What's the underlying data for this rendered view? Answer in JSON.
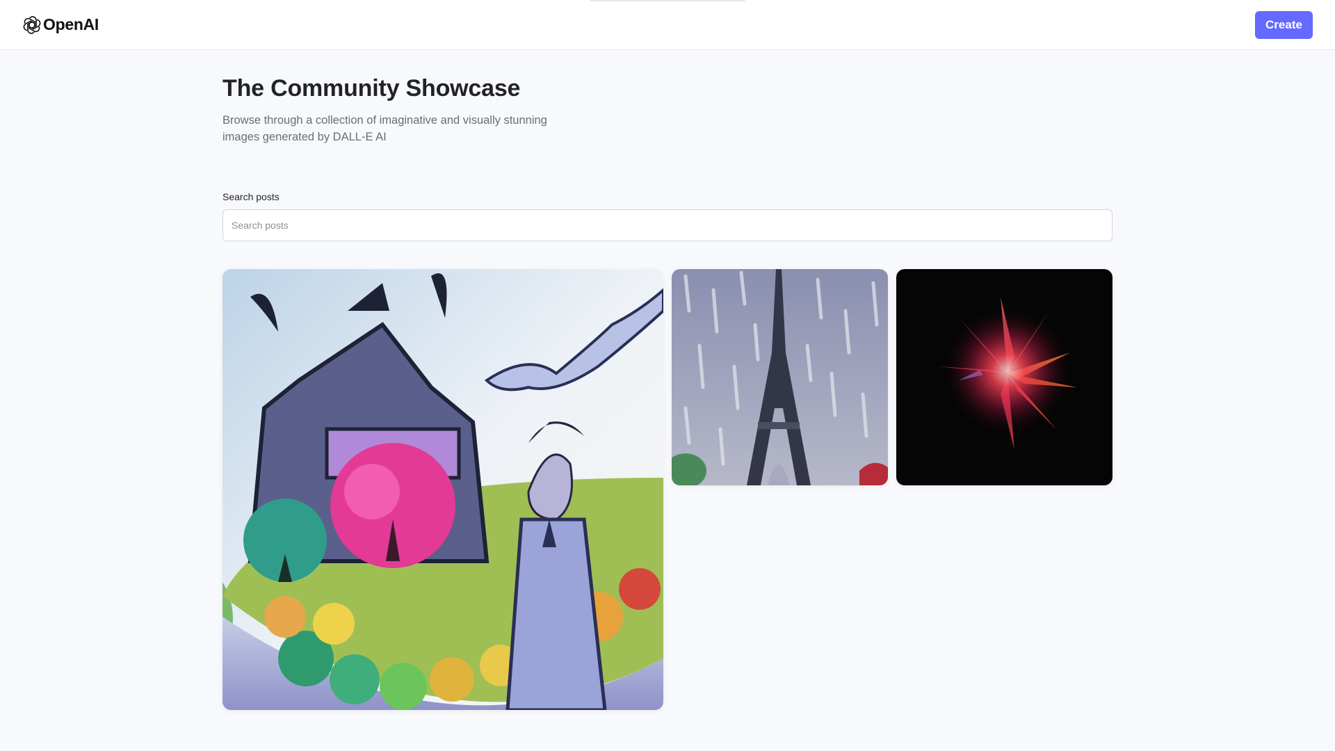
{
  "header": {
    "logo_text": "OpenAI",
    "logo_icon": "openai-logo-icon",
    "create_label": "Create"
  },
  "main": {
    "title": "The Community Showcase",
    "subtitle": "Browse through a collection of imaginative and visually stunning images generated by DALL-E AI"
  },
  "search": {
    "label": "Search posts",
    "placeholder": "Search posts",
    "value": ""
  },
  "colors": {
    "accent": "#6469ff",
    "page_background": "#f8f9fc",
    "title_text": "#222328",
    "subtitle_text": "#666e75"
  }
}
